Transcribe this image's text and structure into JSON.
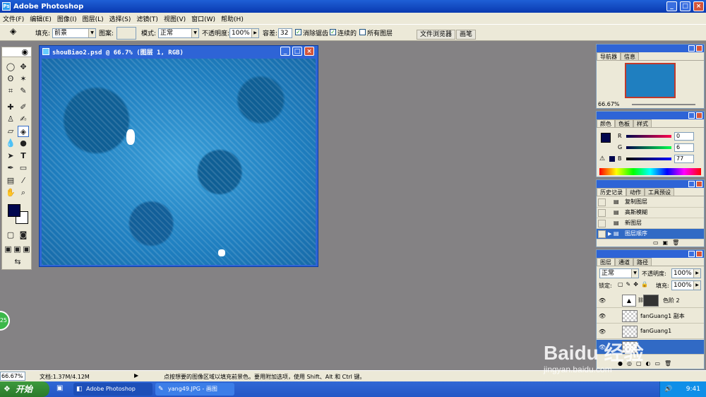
{
  "app": {
    "title": "Adobe Photoshop"
  },
  "menu": [
    "文件(F)",
    "编辑(E)",
    "图像(I)",
    "图层(L)",
    "选择(S)",
    "滤镜(T)",
    "视图(V)",
    "窗口(W)",
    "帮助(H)"
  ],
  "options": {
    "fill_label": "填充:",
    "fill_value": "前景",
    "pattern_label": "图案:",
    "mode_label": "模式:",
    "mode_value": "正常",
    "opacity_label": "不透明度:",
    "opacity_value": "100%",
    "tolerance_label": "容差:",
    "tolerance_value": "32",
    "antialias_label": "消除锯齿",
    "antialias_checked": true,
    "contiguous_label": "连续的",
    "contiguous_checked": true,
    "all_layers_label": "所有图层",
    "all_layers_checked": false,
    "file_browser": "文件浏览器",
    "brushes": "画笔"
  },
  "document": {
    "title": "shouBiao2.psd @ 66.7% (图层 1, RGB)"
  },
  "navigator": {
    "tabs": [
      "导航器",
      "信息"
    ],
    "zoom": "66.67%"
  },
  "color_panel": {
    "tabs": [
      "颜色",
      "色板",
      "样式"
    ],
    "r_label": "R",
    "r_value": "0",
    "g_label": "G",
    "g_value": "6",
    "b_label": "B",
    "b_value": "77",
    "foreground": "#00064d"
  },
  "history": {
    "tabs": [
      "历史记录",
      "动作",
      "工具预设"
    ],
    "items": [
      {
        "label": "复制图层"
      },
      {
        "label": "高斯模糊"
      },
      {
        "label": "新图层"
      },
      {
        "label": "图层顺序"
      }
    ]
  },
  "layers": {
    "tabs": [
      "图层",
      "通道",
      "路径"
    ],
    "blend_mode": "正常",
    "opacity_label": "不透明度:",
    "opacity": "100%",
    "lock_label": "锁定:",
    "fill_label": "填充:",
    "fill": "100%",
    "items": [
      {
        "name": "色阶 2"
      },
      {
        "name": "fanGuang1 副本"
      },
      {
        "name": "fanGuang1"
      }
    ]
  },
  "status": {
    "zoom": "66.67%",
    "doc_info": "文档:1.37M/4.12M",
    "hint": "点按想要的图像区域以填充前景色。要用附加选项，使用 Shift、Alt 和 Ctrl 键。"
  },
  "taskbar": {
    "start": "开始",
    "items": [
      "Adobe Photoshop",
      "yang49.JPG - 画图"
    ],
    "clock": "9:41"
  },
  "watermark": {
    "line1": "Baidu 经验",
    "line2": "jingyan.baidu.com"
  },
  "badge": "25",
  "colors": {
    "accent": "#2e64d6",
    "canvas_blue": "#1f7fc0",
    "workspace": "#848284"
  }
}
